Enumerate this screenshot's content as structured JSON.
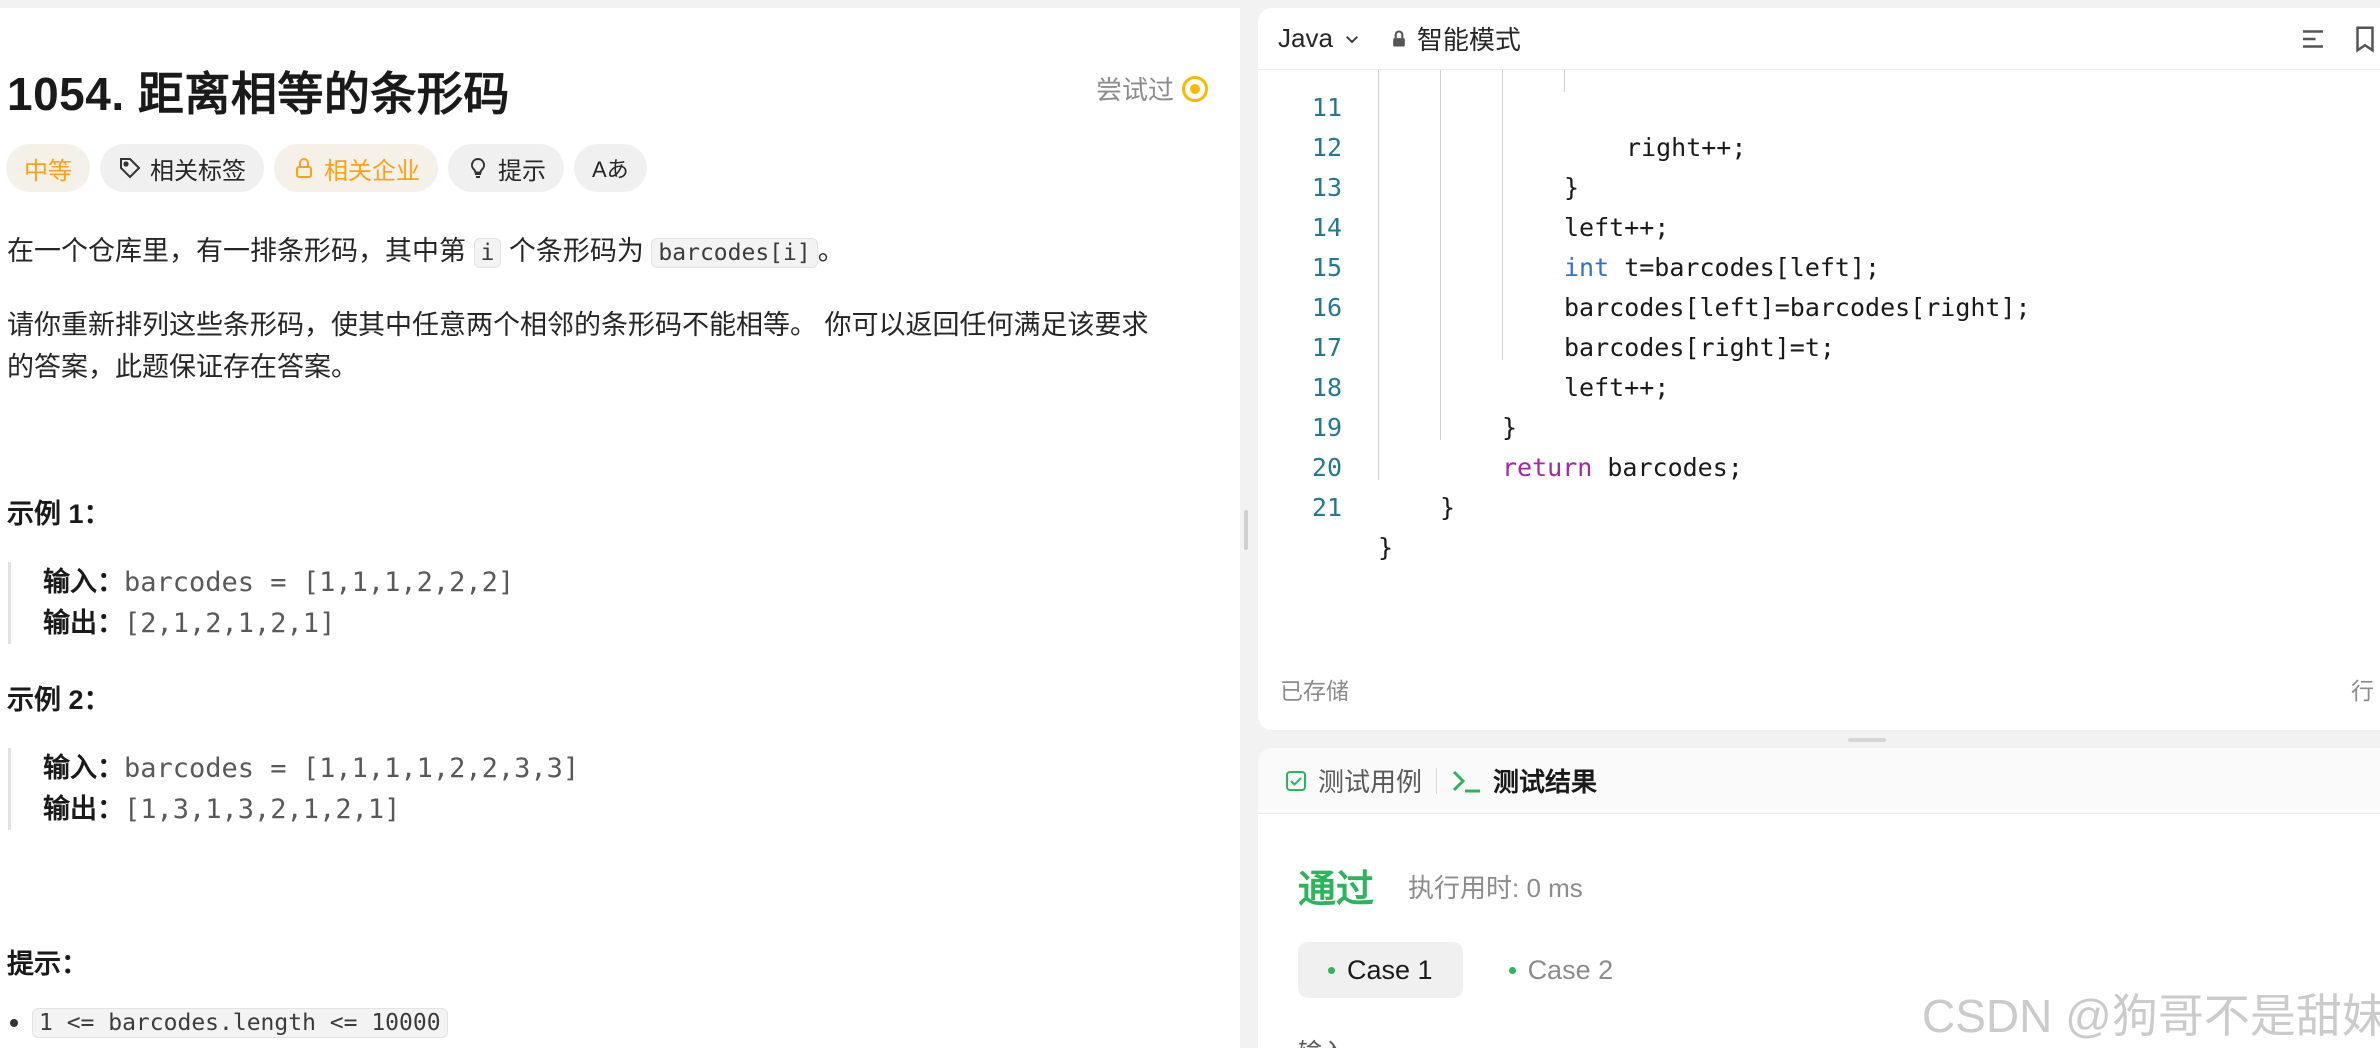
{
  "problem": {
    "title": "1054. 距离相等的条形码",
    "status": "尝试过",
    "tags": {
      "difficulty": "中等",
      "related_tags": "相关标签",
      "related_companies": "相关企业",
      "hint": "提示",
      "translate_glyph": "Aあ"
    },
    "desc1_pre": "在一个仓库里，有一排条形码，其中第",
    "desc1_code1": "i",
    "desc1_mid": "个条形码为",
    "desc1_code2": "barcodes[i]",
    "desc1_post": "。",
    "desc2_line1": "请你重新排列这些条形码，使其中任意两个相邻的条形码不能相等。 你可以返回任何满足该要求",
    "desc2_line2": "的答案，此题保证存在答案。",
    "example1": {
      "heading": "示例 1：",
      "input_label": "输入：",
      "input_value": "barcodes = [1,1,1,2,2,2]",
      "output_label": "输出：",
      "output_value": "[2,1,2,1,2,1]"
    },
    "example2": {
      "heading": "示例 2：",
      "input_label": "输入：",
      "input_value": "barcodes = [1,1,1,1,2,2,3,3]",
      "output_label": "输出：",
      "output_value": "[1,3,1,3,2,1,2,1]"
    },
    "hints_heading": "提示：",
    "constraint": "1 <= barcodes.length <= 10000"
  },
  "editor": {
    "language": "Java",
    "mode": "智能模式",
    "saved": "已存储",
    "row_label": "行",
    "lines": [
      {
        "n": "11",
        "text": "right++;"
      },
      {
        "n": "12",
        "text": "}"
      },
      {
        "n": "13",
        "text": "left++;"
      },
      {
        "n": "14",
        "kw": "int",
        "text": " t=barcodes[left];"
      },
      {
        "n": "15",
        "text": "barcodes[left]=barcodes[right];"
      },
      {
        "n": "16",
        "text": "barcodes[right]=t;"
      },
      {
        "n": "17",
        "text": "left++;"
      },
      {
        "n": "18",
        "text": "}"
      },
      {
        "n": "19",
        "kw": "return",
        "text": " barcodes;"
      },
      {
        "n": "20",
        "text": "}"
      },
      {
        "n": "21",
        "text": "}"
      }
    ]
  },
  "results": {
    "tab_testcase": "测试用例",
    "tab_result": "测试结果",
    "status": "通过",
    "runtime": "执行用时: 0 ms",
    "case1": "Case 1",
    "case2": "Case 2",
    "input_label": "输入"
  },
  "watermark": "CSDN @狗哥不是甜妹",
  "colors": {
    "accent_orange": "#ffa116",
    "pass_green": "#2db55d",
    "line_number": "#237893",
    "keyword_int": "#2f6fd6",
    "keyword_return": "#a626a4"
  }
}
